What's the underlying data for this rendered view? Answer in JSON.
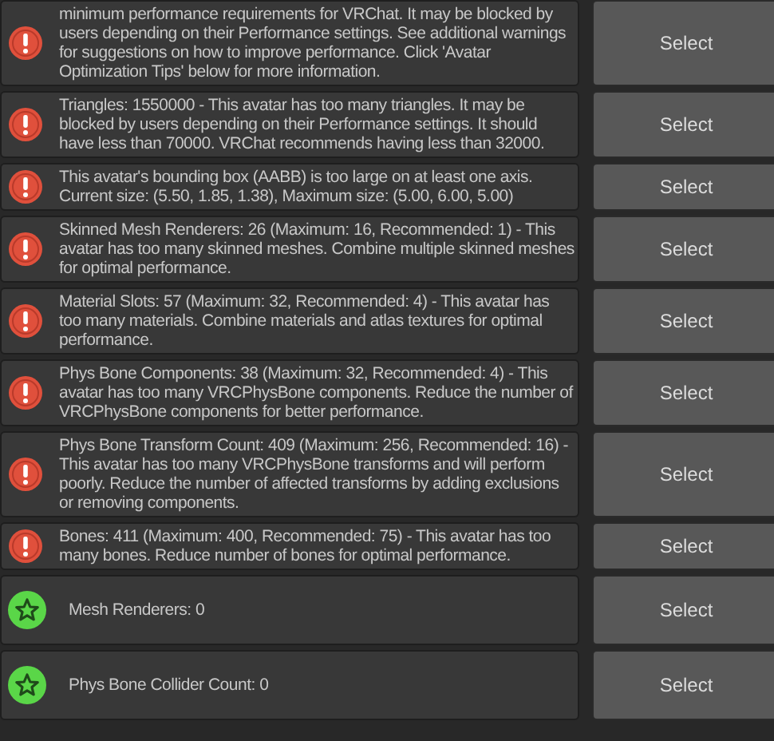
{
  "messages": [
    {
      "kind": "error",
      "text": "minimum performance requirements for VRChat. It may be blocked by users depending on their Performance settings. See additional warnings for suggestions on how to improve performance. Click 'Avatar Optimization Tips' below for more information.",
      "button": "Select"
    },
    {
      "kind": "error",
      "text": "Triangles: 1550000 - This avatar has too many triangles. It may be blocked by users depending on their Performance settings. It should have less than 70000. VRChat recommends having less than 32000.",
      "button": "Select"
    },
    {
      "kind": "error",
      "text": "This avatar's bounding box (AABB) is too large on at least one axis. Current size: (5.50, 1.85, 1.38), Maximum size: (5.00, 6.00, 5.00)",
      "button": "Select"
    },
    {
      "kind": "error",
      "text": "Skinned Mesh Renderers: 26 (Maximum: 16, Recommended: 1) - This avatar has too many skinned meshes. Combine multiple skinned meshes for optimal performance.",
      "button": "Select"
    },
    {
      "kind": "error",
      "text": "Material Slots: 57 (Maximum: 32, Recommended: 4) - This avatar has too many materials. Combine materials and atlas textures for optimal performance.",
      "button": "Select"
    },
    {
      "kind": "error",
      "text": "Phys Bone Components: 38 (Maximum: 32, Recommended: 4) - This avatar has too many VRCPhysBone components. Reduce the number of VRCPhysBone components for better performance.",
      "button": "Select"
    },
    {
      "kind": "error",
      "text": "Phys Bone Transform Count: 409 (Maximum: 256, Recommended: 16) - This avatar has too many VRCPhysBone transforms and will perform poorly. Reduce the number of affected transforms by adding exclusions or removing components.",
      "button": "Select"
    },
    {
      "kind": "error",
      "text": "Bones: 411 (Maximum: 400, Recommended: 75) - This avatar has too many bones. Reduce number of bones for optimal performance.",
      "button": "Select"
    },
    {
      "kind": "good",
      "text": "Mesh Renderers: 0",
      "button": "Select"
    },
    {
      "kind": "good",
      "text": "Phys Bone Collider Count: 0",
      "button": "Select"
    }
  ]
}
